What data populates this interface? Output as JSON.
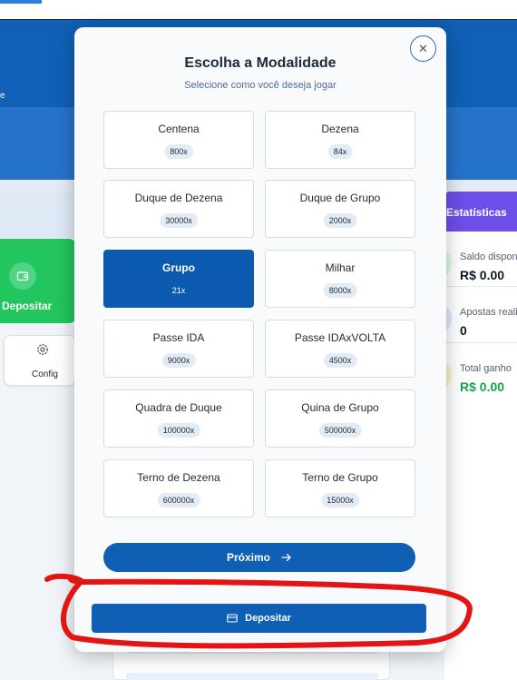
{
  "background": {
    "hero_fragment": "e",
    "deposit_tile_label": "Depositar",
    "config_tile_label": "Config",
    "stats": {
      "title": "Estatísticas",
      "items": [
        {
          "label": "Saldo dispon",
          "value": "R$ 0.00",
          "color": "#22c55e"
        },
        {
          "label": "Apostas reali",
          "value": "0",
          "color": "#3b82f6"
        },
        {
          "label": "Total ganho",
          "value": "R$ 0.00",
          "color": "#eab308"
        }
      ]
    }
  },
  "modal": {
    "title": "Escolha a Modalidade",
    "subtitle": "Selecione como você deseja jogar",
    "close_icon": "close-icon",
    "options": [
      {
        "name": "Centena",
        "multiplier": "800x",
        "selected": false
      },
      {
        "name": "Dezena",
        "multiplier": "84x",
        "selected": false
      },
      {
        "name": "Duque de Dezena",
        "multiplier": "30000x",
        "selected": false
      },
      {
        "name": "Duque de Grupo",
        "multiplier": "2000x",
        "selected": false
      },
      {
        "name": "Grupo",
        "multiplier": "21x",
        "selected": true
      },
      {
        "name": "Milhar",
        "multiplier": "8000x",
        "selected": false
      },
      {
        "name": "Passe IDA",
        "multiplier": "9000x",
        "selected": false
      },
      {
        "name": "Passe IDAxVOLTA",
        "multiplier": "4500x",
        "selected": false
      },
      {
        "name": "Quadra de Duque",
        "multiplier": "100000x",
        "selected": false
      },
      {
        "name": "Quina de Grupo",
        "multiplier": "500000x",
        "selected": false
      },
      {
        "name": "Terno de Dezena",
        "multiplier": "600000x",
        "selected": false
      },
      {
        "name": "Terno de Grupo",
        "multiplier": "15000x",
        "selected": false
      }
    ],
    "next_label": "Próximo",
    "deposit_label": "Depositar"
  },
  "colors": {
    "primary": "#0f5fb4",
    "selected": "#0c5bb0",
    "deposit_green": "#22c55e",
    "stats_purple": "#6d4ee8",
    "annotation_red": "#e31414"
  }
}
